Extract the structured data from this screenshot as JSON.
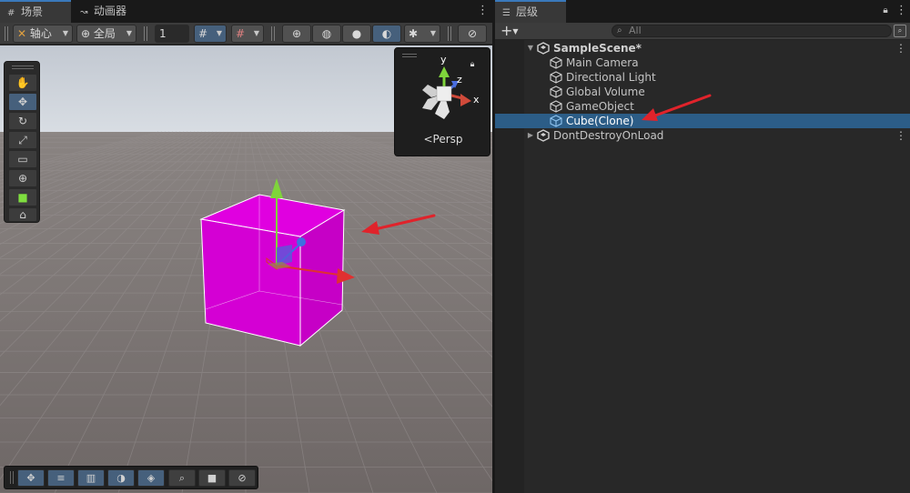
{
  "scene_tabs": [
    {
      "label": "场景",
      "icon": "grid-icon",
      "active": true
    },
    {
      "label": "动画器",
      "icon": "animator-icon",
      "active": false
    }
  ],
  "scene_toolbar": {
    "pivot_label": "轴心",
    "global_label": "全局",
    "grid_value": "1"
  },
  "gizmo": {
    "x_axis": "x",
    "y_axis": "y",
    "z_axis": "z",
    "projection_label": "Persp"
  },
  "tools": [
    {
      "name": "hand-tool",
      "glyph": "✋"
    },
    {
      "name": "move-tool",
      "glyph": "✥",
      "selected": true
    },
    {
      "name": "rotate-tool",
      "glyph": "↻"
    },
    {
      "name": "scale-tool",
      "glyph": "⤢"
    },
    {
      "name": "rect-tool",
      "glyph": "▭"
    },
    {
      "name": "transform-tool",
      "glyph": "⊕"
    },
    {
      "name": "custom-tool",
      "glyph": "■"
    },
    {
      "name": "component-tool",
      "glyph": "⌂"
    }
  ],
  "bottom_overlay": [
    {
      "name": "move-overlay-button",
      "glyph": "✥",
      "selected": true
    },
    {
      "name": "snap-settings-button",
      "glyph": "≡",
      "selected": true
    },
    {
      "name": "grid-snap-button",
      "glyph": "▥",
      "selected": true
    },
    {
      "name": "shading-button",
      "glyph": "◑",
      "selected": true
    },
    {
      "name": "layers-button",
      "glyph": "◈",
      "selected": true
    },
    {
      "name": "search-overlay-button",
      "glyph": "⌕",
      "selected": false
    },
    {
      "name": "camera-overlay-button",
      "glyph": "■",
      "selected": false
    },
    {
      "name": "navigation-overlay-button",
      "glyph": "⊘",
      "selected": false
    }
  ],
  "hierarchy": {
    "tab_label": "层级",
    "search_placeholder": "All",
    "add_label": "+",
    "rows": [
      {
        "label": "SampleScene*",
        "type": "scene",
        "bold": true
      },
      {
        "label": "Main Camera",
        "type": "object"
      },
      {
        "label": "Directional Light",
        "type": "object"
      },
      {
        "label": "Global Volume",
        "type": "object"
      },
      {
        "label": "GameObject",
        "type": "object"
      },
      {
        "label": "Cube(Clone)",
        "type": "object",
        "selected": true
      },
      {
        "label": "DontDestroyOnLoad",
        "type": "scene"
      }
    ]
  },
  "colors": {
    "selection": "#2c5d87",
    "cube": "#d000d0",
    "annotation_arrow": "#e0232b",
    "floor": "#7a7372",
    "sky": "#c7ccd5"
  }
}
